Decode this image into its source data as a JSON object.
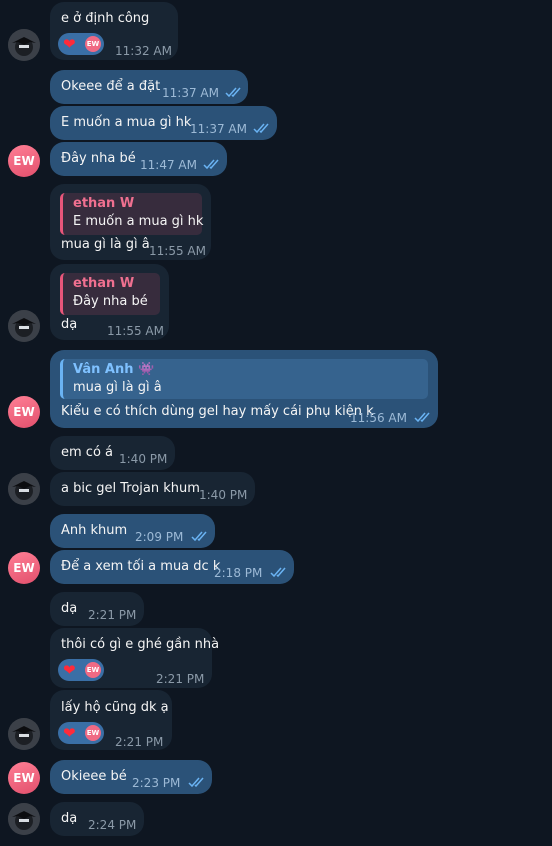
{
  "messages": [
    {
      "text": "e ở định công",
      "time": "11:32 AM"
    },
    {
      "text": "Okeee để a đặt",
      "time": "11:37 AM"
    },
    {
      "text": "E muốn a mua gì hk",
      "time": "11:37 AM"
    },
    {
      "text": "Đây nha bé",
      "time": "11:47 AM"
    },
    {
      "text": "mua gì là gì â",
      "time": "11:55 AM",
      "quote_name": "ethan W",
      "quote_text": "E muốn a mua gì hk"
    },
    {
      "text": "dạ",
      "time": "11:55 AM",
      "quote_name": "ethan W",
      "quote_text": "Đây nha bé"
    },
    {
      "text": "Kiểu e có thích dùng gel hay mấy cái phụ kiện k",
      "time": "11:56 AM",
      "quote_name": "Vân Anh 👾",
      "quote_text": "mua gì là gì â"
    },
    {
      "text": "em có á",
      "time": "1:40 PM"
    },
    {
      "text": "a bic gel Trojan khum",
      "time": "1:40 PM"
    },
    {
      "text": "Anh khum",
      "time": "2:09 PM"
    },
    {
      "text": "Để a xem tối a mua dc k",
      "time": "2:18 PM"
    },
    {
      "text": "dạ",
      "time": "2:21 PM"
    },
    {
      "text": "thôi có gì e ghé gần nhà",
      "time": "2:21 PM"
    },
    {
      "text": "lấy hộ cũng dk ạ",
      "time": "2:21 PM"
    },
    {
      "text": "Okieee bé",
      "time": "2:23 PM"
    },
    {
      "text": "dạ",
      "time": "2:24 PM"
    }
  ],
  "avatar_initials": "EW",
  "reaction": {
    "emoji": "❤️",
    "avatar": "EW"
  },
  "colors": {
    "background": "#0e1621",
    "incoming": "#182533",
    "outgoing": "#2b5278",
    "accent": "#6ab3f3"
  }
}
